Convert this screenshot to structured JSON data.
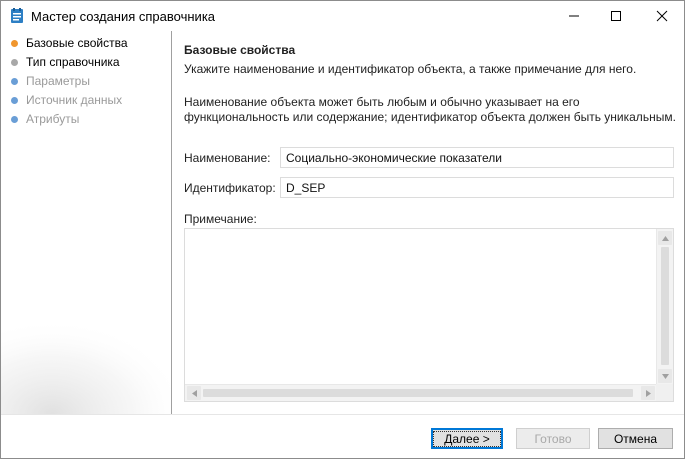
{
  "window": {
    "title": "Мастер создания справочника"
  },
  "nav": {
    "items": [
      {
        "label": "Базовые свойства",
        "state": "current",
        "dot_color": "#f0962e"
      },
      {
        "label": "Тип справочника",
        "state": "enabled",
        "dot_color": "#a8a8a8"
      },
      {
        "label": "Параметры",
        "state": "disabled",
        "dot_color": "#6a9ed6"
      },
      {
        "label": "Источник данных",
        "state": "disabled",
        "dot_color": "#6a9ed6"
      },
      {
        "label": "Атрибуты",
        "state": "disabled",
        "dot_color": "#6a9ed6"
      }
    ]
  },
  "page": {
    "heading": "Базовые свойства",
    "subheading": "Укажите наименование и идентификатор объекта, а также примечание для него.",
    "description": "Наименование объекта может быть любым и обычно указывает на его функциональность или содержание; идентификатор объекта должен быть уникальным."
  },
  "form": {
    "name_label": "Наименование:",
    "name_value": "Социально-экономические показатели",
    "id_label": "Идентификатор:",
    "id_value": "D_SEP",
    "note_label": "Примечание:",
    "note_value": ""
  },
  "footer": {
    "next_label": "Далее >",
    "done_label": "Готово",
    "cancel_label": "Отмена"
  },
  "colors": {
    "accent": "#0078d7",
    "current_step": "#f0962e",
    "disabled_text": "#9a9a9a"
  }
}
